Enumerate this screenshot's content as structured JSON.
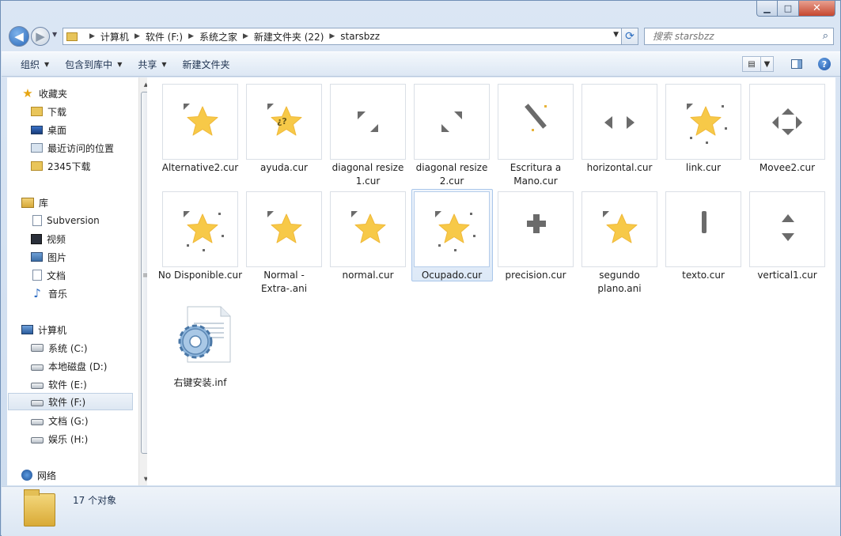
{
  "window": {
    "controls": {
      "minimize": "▁",
      "maximize": "□",
      "close": "✕"
    }
  },
  "nav": {
    "back_icon": "back-arrow-icon",
    "forward_icon": "forward-arrow-icon",
    "address": {
      "crumbs": [
        "计算机",
        "软件 (F:)",
        "系统之家",
        "新建文件夹 (22)",
        "starsbzz"
      ]
    },
    "search": {
      "placeholder": "搜索 starsbzz"
    }
  },
  "toolbar": {
    "organize": "组织",
    "include_in_library": "包含到库中",
    "share": "共享",
    "new_folder": "新建文件夹"
  },
  "sidebar": {
    "favorites": {
      "header": "收藏夹",
      "items": [
        "下载",
        "桌面",
        "最近访问的位置",
        "2345下载"
      ]
    },
    "libraries": {
      "header": "库",
      "items": [
        "Subversion",
        "视频",
        "图片",
        "文档",
        "音乐"
      ]
    },
    "computer": {
      "header": "计算机",
      "items": [
        "系统 (C:)",
        "本地磁盘 (D:)",
        "软件 (E:)",
        "软件 (F:)",
        "文档 (G:)",
        "娱乐 (H:)"
      ]
    },
    "network": {
      "header": "网络"
    }
  },
  "files": [
    {
      "name": "Alternative2.cur",
      "kind": "star"
    },
    {
      "name": "ayuda.cur",
      "kind": "star-help"
    },
    {
      "name": "diagonal resize 1.cur",
      "kind": "diag1"
    },
    {
      "name": "diagonal resize 2.cur",
      "kind": "diag2"
    },
    {
      "name": "Escritura a Mano.cur",
      "kind": "pen"
    },
    {
      "name": "horizontal.cur",
      "kind": "horizontal"
    },
    {
      "name": "link.cur",
      "kind": "star-link"
    },
    {
      "name": "Movee2.cur",
      "kind": "move"
    },
    {
      "name": "No Disponible.cur",
      "kind": "star-sparkle"
    },
    {
      "name": "Normal -Extra-.ani",
      "kind": "star"
    },
    {
      "name": "normal.cur",
      "kind": "star"
    },
    {
      "name": "Ocupado.cur",
      "kind": "star-busy"
    },
    {
      "name": "precision.cur",
      "kind": "cross"
    },
    {
      "name": "segundo plano.ani",
      "kind": "star"
    },
    {
      "name": "texto.cur",
      "kind": "text"
    },
    {
      "name": "vertical1.cur",
      "kind": "vertical"
    },
    {
      "name": "右键安装.inf",
      "kind": "inf"
    }
  ],
  "selected_file": "Ocupado.cur",
  "status": {
    "count": "17 个对象"
  },
  "colors": {
    "star": "#F7C948",
    "cursor_gray": "#6b6b6b",
    "selection": "#dde9f7"
  }
}
